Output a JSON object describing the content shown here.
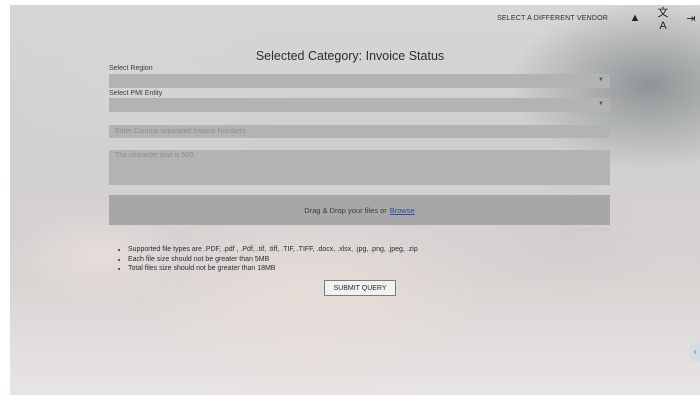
{
  "header": {
    "vendor_link": "SELECT A DIFFERENT VENDOR",
    "icons": [
      "home-icon",
      "translate-icon",
      "logout-icon"
    ]
  },
  "page": {
    "title": "Selected Category: Invoice Status"
  },
  "form": {
    "region_label": "Select Region",
    "region_value": "",
    "entity_label": "Select PMI Entity",
    "entity_value": "",
    "invoice_placeholder": "Enter Comma separated Invoice Numbers",
    "comment_placeholder": "The character limit is 500.",
    "dropzone_text": "Drag & Drop your files or",
    "browse_label": "Browse",
    "powered_by": "Powered by Filepond",
    "notes": [
      "Supported file types are .PDF, .pdf , .Pdf, .tif, .tiff, .TIF, .TIFF, .docx, .xlsx, .jpg, .png, .jpeg, .zip",
      "Each file size should not be greater than 5MB",
      "Total files size should not be greater than 18MB"
    ],
    "submit_label": "SUBMIT QUERY"
  },
  "side_tab": {
    "glyph": "‹"
  }
}
